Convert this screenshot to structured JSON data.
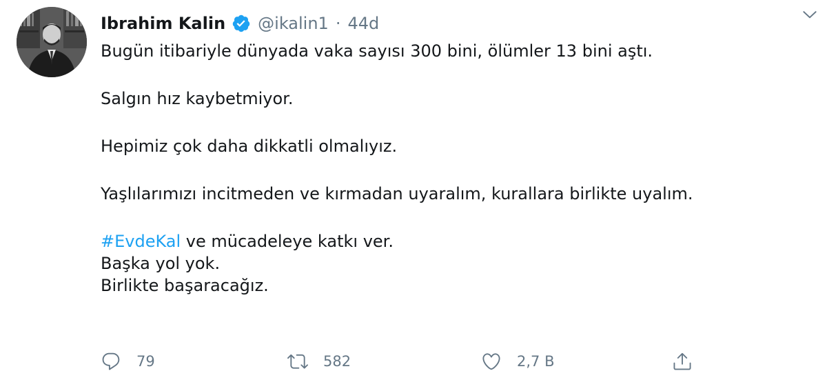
{
  "author": {
    "name": "Ibrahim Kalin",
    "handle": "@ikalin1",
    "separator": "·",
    "timestamp": "44d",
    "verified": true
  },
  "tweet": {
    "line1": "Bugün itibariyle dünyada vaka sayısı 300 bini, ölümler 13 bini aştı.",
    "line2": "Salgın hız kaybetmiyor.",
    "line3": "Hepimiz çok daha dikkatli olmalıyız.",
    "line4": "Yaşlılarımızı incitmeden ve kırmadan uyaralım, kurallara birlikte uyalım.",
    "hashtag": "#EvdeKal",
    "line5_rest": " ve mücadeleye katkı ver.",
    "line6": "Başka yol yok.",
    "line7": "Birlikte başaracağız."
  },
  "actions": {
    "reply_count": "79",
    "retweet_count": "582",
    "like_count": "2,7 B"
  },
  "colors": {
    "text": "#14171a",
    "secondary": "#657786",
    "link": "#1da1f2",
    "verified": "#1da1f2"
  },
  "icons": [
    "avatar-photo",
    "verified-badge-icon",
    "caret-down-icon",
    "reply-icon",
    "retweet-icon",
    "like-icon",
    "share-icon"
  ]
}
